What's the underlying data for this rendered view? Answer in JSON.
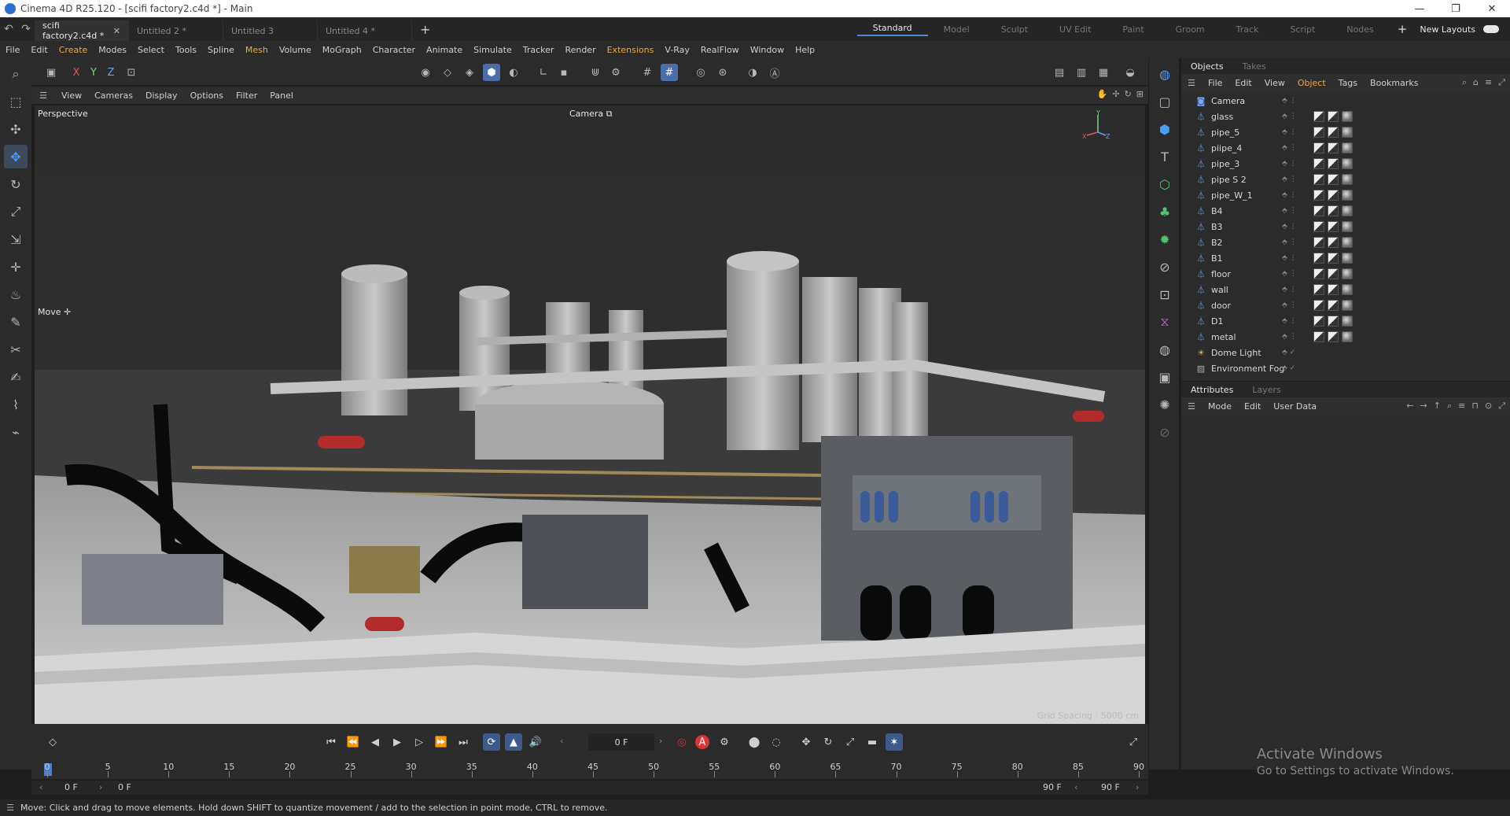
{
  "window": {
    "title": "Cinema 4D R25.120 - [scifi factory2.c4d *] - Main",
    "controls": [
      "—",
      "❐",
      "✕"
    ]
  },
  "tabs": [
    {
      "label": "scifi factory2.c4d *",
      "active": true
    },
    {
      "label": "Untitled 2 *"
    },
    {
      "label": "Untitled 3"
    },
    {
      "label": "Untitled 4 *"
    }
  ],
  "layouts": {
    "items": [
      "Standard",
      "Model",
      "Sculpt",
      "UV Edit",
      "Paint",
      "Groom",
      "Track",
      "Script",
      "Nodes"
    ],
    "active": "Standard",
    "new_layouts": "New Layouts"
  },
  "menu": [
    "File",
    "Edit",
    "Create",
    "Modes",
    "Select",
    "Tools",
    "Spline",
    "Mesh",
    "Volume",
    "MoGraph",
    "Character",
    "Animate",
    "Simulate",
    "Tracker",
    "Render",
    "Extensions",
    "V-Ray",
    "RealFlow",
    "Window",
    "Help"
  ],
  "menu_highlight": [
    "Create",
    "Mesh",
    "Extensions"
  ],
  "coord_toolbar": {
    "x": "X",
    "y": "Y",
    "z": "Z"
  },
  "viewport": {
    "menu": [
      "View",
      "Cameras",
      "Display",
      "Options",
      "Filter",
      "Panel"
    ],
    "projection": "Perspective",
    "camera": "Camera",
    "tool": "Move",
    "grid_spacing": "Grid Spacing : 5000 cm",
    "axis": {
      "y": "Y",
      "x": "X",
      "z": "Z"
    }
  },
  "objects_panel": {
    "tabs": [
      "Objects",
      "Takes"
    ],
    "menu": [
      "File",
      "Edit",
      "View",
      "Object",
      "Tags",
      "Bookmarks"
    ],
    "active_menu": "Object",
    "objects": [
      {
        "name": "Camera",
        "icon": "camera-icon"
      },
      {
        "name": "glass",
        "icon": "mesh-icon"
      },
      {
        "name": "pipe_5",
        "icon": "mesh-icon"
      },
      {
        "name": "piipe_4",
        "icon": "mesh-icon"
      },
      {
        "name": "pipe_3",
        "icon": "mesh-icon"
      },
      {
        "name": "pipe S 2",
        "icon": "mesh-icon"
      },
      {
        "name": "pipe_W_1",
        "icon": "mesh-icon"
      },
      {
        "name": "B4",
        "icon": "mesh-icon"
      },
      {
        "name": "B3",
        "icon": "mesh-icon"
      },
      {
        "name": "B2",
        "icon": "mesh-icon"
      },
      {
        "name": "B1",
        "icon": "mesh-icon"
      },
      {
        "name": "floor",
        "icon": "mesh-icon"
      },
      {
        "name": "wall",
        "icon": "mesh-icon"
      },
      {
        "name": "door",
        "icon": "mesh-icon"
      },
      {
        "name": "D1",
        "icon": "mesh-icon"
      },
      {
        "name": "metal",
        "icon": "mesh-icon"
      },
      {
        "name": "Dome Light",
        "icon": "light-icon"
      },
      {
        "name": "Environment Fog",
        "icon": "fog-icon"
      }
    ]
  },
  "attributes_panel": {
    "tabs": [
      "Attributes",
      "Layers"
    ],
    "menu": [
      "Mode",
      "Edit",
      "User Data"
    ]
  },
  "timeline": {
    "current_frame": "0 F",
    "ticks": [
      "0",
      "5",
      "10",
      "15",
      "20",
      "25",
      "30",
      "35",
      "40",
      "45",
      "50",
      "55",
      "60",
      "65",
      "70",
      "75",
      "80",
      "85",
      "90"
    ],
    "range_start": "0 F",
    "range_start2": "0 F",
    "range_end": "90 F",
    "range_end2": "90 F"
  },
  "status": "Move: Click and drag to move elements. Hold down SHIFT to quantize movement / add to the selection in point mode, CTRL to remove.",
  "watermark": {
    "line1": "Activate Windows",
    "line2": "Go to Settings to activate Windows."
  },
  "colors": {
    "accent": "#4a9df6",
    "highlight": "#f0a838",
    "record": "#dd3333"
  }
}
